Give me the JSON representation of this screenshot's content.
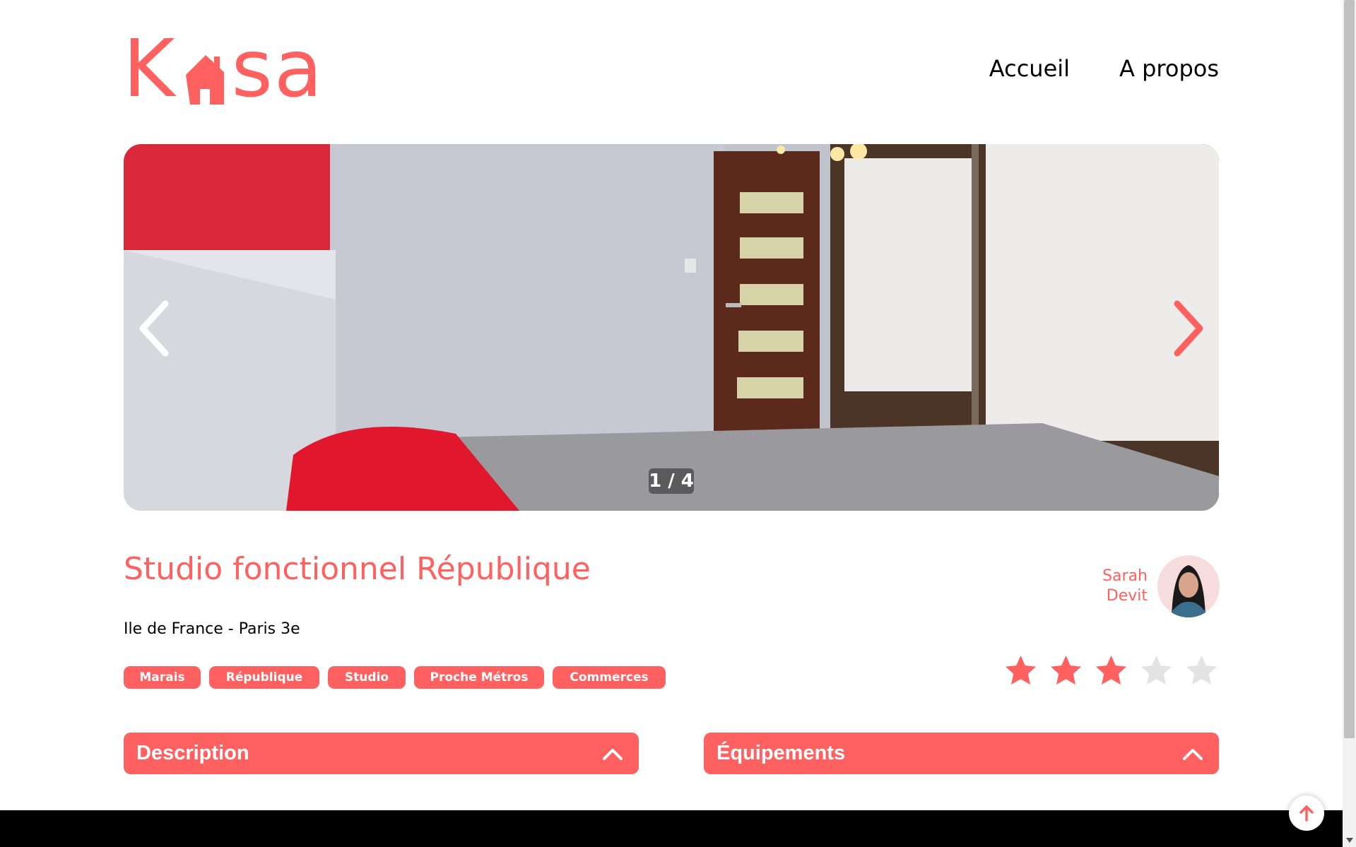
{
  "header": {
    "logo_text_left": "K",
    "logo_text_right": "sa",
    "nav": [
      {
        "label": "Accueil"
      },
      {
        "label": "A propos"
      }
    ]
  },
  "carousel": {
    "counter": "1 / 4",
    "current": 1,
    "total": 4
  },
  "listing": {
    "title": "Studio fonctionnel République",
    "location": "Ile de France - Paris 3e",
    "tags": [
      "Marais",
      "République",
      "Studio",
      "Proche Métros",
      "Commerces"
    ],
    "host": {
      "first_name": "Sarah",
      "last_name": "Devit"
    },
    "rating": 3,
    "rating_max": 5
  },
  "sections": {
    "description": "Description",
    "equipment": "Équipements"
  },
  "colors": {
    "accent": "#FF6060",
    "star_empty": "#E3E3E3",
    "footer": "#000000"
  },
  "icons": {
    "prev": "chevron-left-icon",
    "next": "chevron-right-icon",
    "collapse": "chevron-up-icon",
    "star": "star-icon",
    "scroll_top": "arrow-up-icon"
  }
}
